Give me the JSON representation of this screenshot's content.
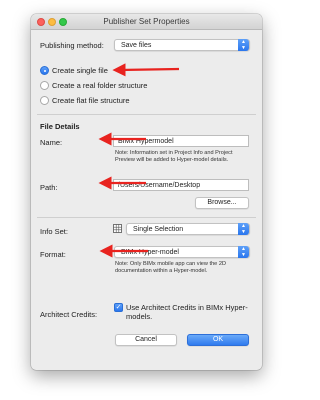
{
  "window": {
    "title": "Publisher Set Properties"
  },
  "publishing": {
    "label": "Publishing method:",
    "value": "Save files",
    "options": [
      {
        "label": "Create single file",
        "selected": true
      },
      {
        "label": "Create a real folder structure",
        "selected": false
      },
      {
        "label": "Create flat file structure",
        "selected": false
      }
    ]
  },
  "file_details": {
    "heading": "File Details",
    "name_label": "Name:",
    "name_value": "BIMx Hypermodel",
    "name_note": "Note: Information set in Project Info and Project Preview will be added to Hyper-model details.",
    "path_label": "Path:",
    "path_value": "/Users/Username/Desktop",
    "browse_label": "Browse..."
  },
  "info_set": {
    "label": "Info Set:",
    "value": "Single Selection"
  },
  "format": {
    "label": "Format:",
    "value": "BIMx Hyper-model",
    "note": "Note: Only BIMx mobile app can view the 2D documentation within a Hyper-model."
  },
  "architect": {
    "label": "Architect Credits:",
    "checkbox_label": "Use Architect Credits in BIMx Hyper-models.",
    "checked": true
  },
  "buttons": {
    "cancel": "Cancel",
    "ok": "OK"
  },
  "colors": {
    "annotation_arrow": "#e8231f",
    "accent": "#2a76ee"
  }
}
